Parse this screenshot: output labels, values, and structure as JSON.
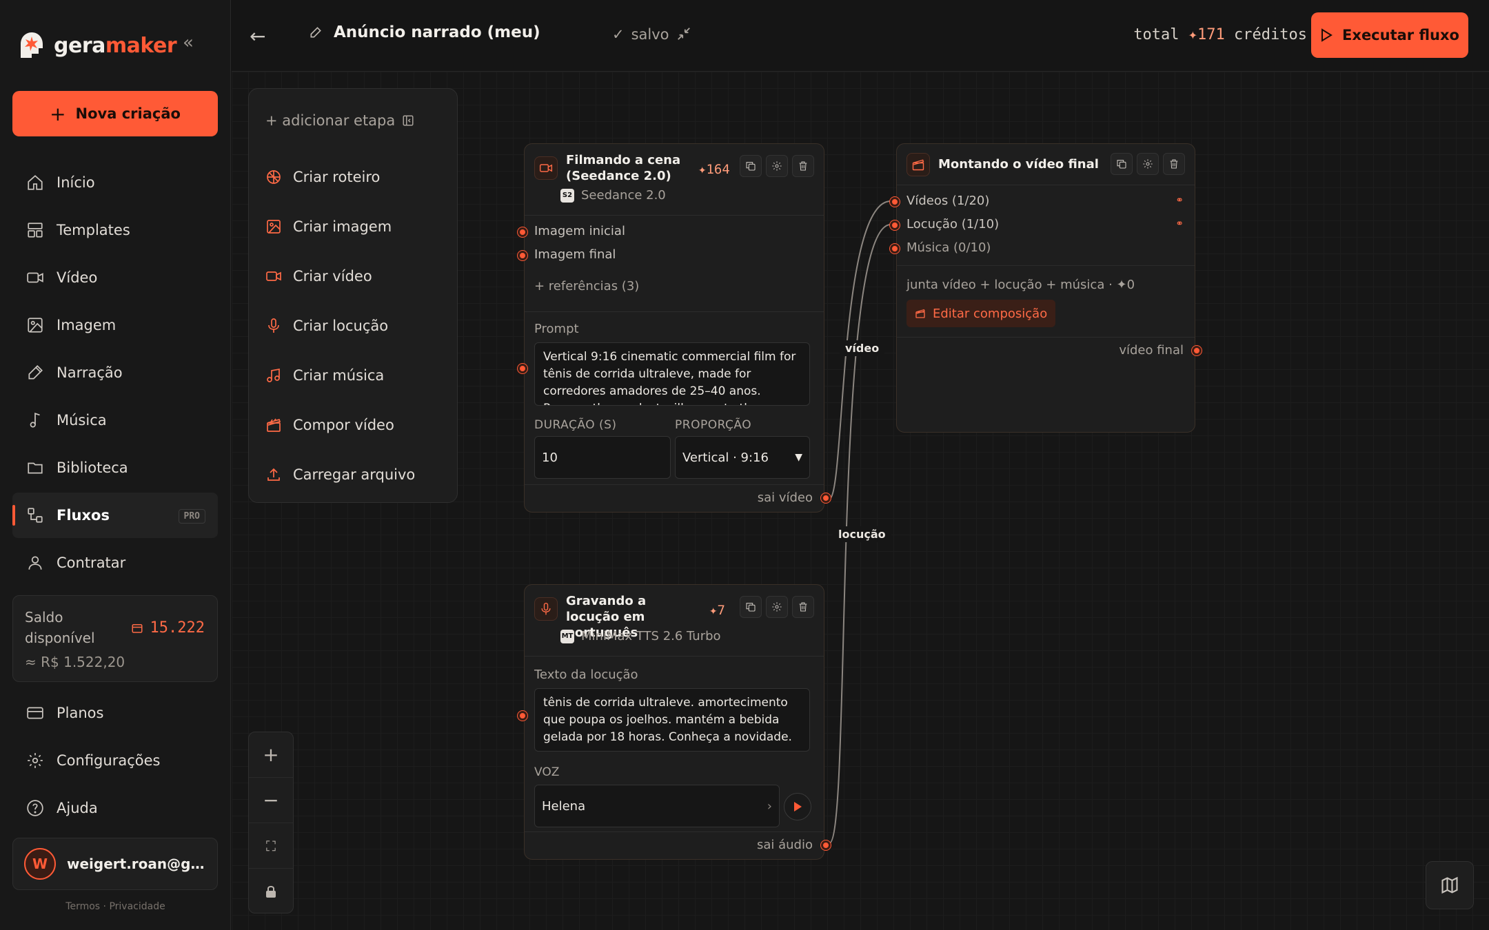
{
  "brand": {
    "part1": "gera",
    "part2": "maker"
  },
  "sidebar": {
    "new_label": "Nova criação",
    "items": [
      {
        "label": "Início",
        "icon": "home-icon"
      },
      {
        "label": "Templates",
        "icon": "templates-icon"
      },
      {
        "label": "Vídeo",
        "icon": "video-icon"
      },
      {
        "label": "Imagem",
        "icon": "image-icon"
      },
      {
        "label": "Narração",
        "icon": "narration-icon"
      },
      {
        "label": "Música",
        "icon": "music-icon"
      },
      {
        "label": "Biblioteca",
        "icon": "folder-icon"
      },
      {
        "label": "Fluxos",
        "icon": "flows-icon",
        "active": true,
        "badge": "PRO"
      },
      {
        "label": "Contratar",
        "icon": "user-icon"
      }
    ],
    "balance": {
      "label": "Saldo disponível",
      "value": "15.222",
      "sub": "≈ R$ 1.522,20"
    },
    "bottom_items": [
      {
        "label": "Planos",
        "icon": "card-icon"
      },
      {
        "label": "Configurações",
        "icon": "gear-icon"
      },
      {
        "label": "Ajuda",
        "icon": "help-icon"
      }
    ],
    "user": {
      "initial": "W",
      "email": "weigert.roan@gm..."
    },
    "legal": {
      "terms": "Termos",
      "sep": "·",
      "privacy": "Privacidade"
    }
  },
  "topbar": {
    "title": "Anúncio narrado (meu)",
    "saved": "salvo",
    "total_prefix": "total",
    "total_amount": "✦171",
    "total_suffix": "créditos",
    "run_label": "Executar fluxo"
  },
  "add_panel": {
    "header": "+ adicionar etapa",
    "items": [
      {
        "label": "Criar roteiro",
        "icon": "script-icon"
      },
      {
        "label": "Criar imagem",
        "icon": "image-icon"
      },
      {
        "label": "Criar vídeo",
        "icon": "video-icon"
      },
      {
        "label": "Criar locução",
        "icon": "mic-icon"
      },
      {
        "label": "Criar música",
        "icon": "music-icon"
      },
      {
        "label": "Compor vídeo",
        "icon": "clapper-icon"
      },
      {
        "label": "Carregar arquivo",
        "icon": "upload-icon"
      }
    ]
  },
  "node_video": {
    "title": "Filmando a cena (Seedance 2.0)",
    "cost": "✦164",
    "model_badge": "S2",
    "model": "Seedance 2.0",
    "inputs": [
      "Imagem inicial",
      "Imagem final"
    ],
    "refs": "+ referências (3)",
    "prompt_label": "Prompt",
    "prompt": "Vertical 9:16 cinematic commercial film for tênis de corrida ultraleve, made for corredores amadores de 25–40 anos. Runner, the product will move to the...",
    "duration_label": "DURAÇÃO (S)",
    "duration": "10",
    "ratio_label": "PROPORÇÃO",
    "ratio": "Vertical · 9:16",
    "output": "sai vídeo"
  },
  "node_voice": {
    "title": "Gravando a locução em português",
    "cost": "✦7",
    "model_badge": "MT",
    "model": "MiniMax TTS 2.6 Turbo",
    "text_label": "Texto da locução",
    "text": "tênis de corrida ultraleve. amortecimento que poupa os joelhos. mantém a bebida gelada por 18 horas. Conheça a novidade.",
    "voice_label": "VOZ",
    "voice": "Helena",
    "output": "sai áudio"
  },
  "node_compose": {
    "title": "Montando o vídeo final",
    "inputs": [
      "Vídeos (1/20)",
      "Locução (1/10)",
      "Música (0/10)"
    ],
    "summary": "junta vídeo + locução + música · ✦0",
    "edit_label": "Editar composição",
    "output": "vídeo final"
  },
  "edges": {
    "video_label": "vídeo",
    "voice_label": "locução"
  },
  "colors": {
    "accent": "#ff5a36",
    "background": "#141414",
    "panel": "#1e1e1e"
  }
}
